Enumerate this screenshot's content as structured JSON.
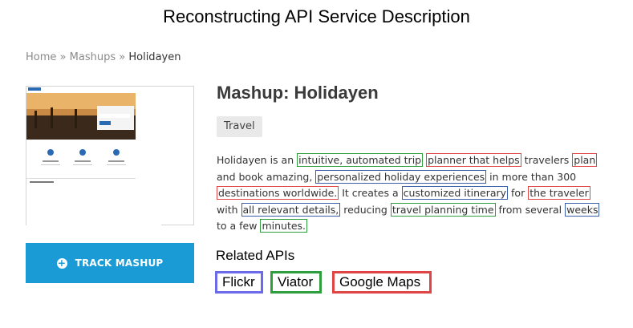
{
  "figure_title": "Reconstructing API Service Description",
  "breadcrumb": {
    "home": "Home",
    "sep1": "»",
    "mashups": "Mashups",
    "sep2": "»",
    "current": "Holidayen"
  },
  "track_button": {
    "label": "TRACK MASHUP",
    "icon": "plus-circle-icon"
  },
  "mashup": {
    "title": "Mashup: Holidayen",
    "tag": "Travel",
    "description_segments": [
      {
        "text": "Holidayen is an ",
        "hl": ""
      },
      {
        "text": "intuitive, automated trip",
        "hl": "green"
      },
      {
        "text": " ",
        "hl": ""
      },
      {
        "text": "planner that helps",
        "hl": "red"
      },
      {
        "text": " travelers ",
        "hl": ""
      },
      {
        "text": "plan",
        "hl": "red"
      },
      {
        "text": " and book amazing, ",
        "hl": ""
      },
      {
        "text": "personalized holiday experiences",
        "hl": "blue"
      },
      {
        "text": " in more than 300 ",
        "hl": ""
      },
      {
        "text": "destinations worldwide.",
        "hl": "red"
      },
      {
        "text": " It creates a ",
        "hl": ""
      },
      {
        "text": "customized itinerary",
        "hl": "blue"
      },
      {
        "text": " for ",
        "hl": ""
      },
      {
        "text": "the traveler",
        "hl": "red"
      },
      {
        "text": " with ",
        "hl": ""
      },
      {
        "text": "all relevant details,",
        "hl": "blue"
      },
      {
        "text": " reducing ",
        "hl": ""
      },
      {
        "text": "travel planning time",
        "hl": "green"
      },
      {
        "text": " from several ",
        "hl": ""
      },
      {
        "text": "weeks",
        "hl": "blue"
      },
      {
        "text": " to a few ",
        "hl": ""
      },
      {
        "text": "minutes.",
        "hl": "green"
      }
    ]
  },
  "related": {
    "heading": "Related APIs",
    "apis": [
      {
        "name": "Flickr",
        "color": "#6b6bea"
      },
      {
        "name": "Viator",
        "color": "#2e9e3e"
      },
      {
        "name": "Google Maps",
        "color": "#e04545"
      }
    ]
  },
  "colors": {
    "accent_button": "#1a9bd6",
    "highlight_green": "#2e9e3e",
    "highlight_red": "#e04545",
    "highlight_blue": "#3a5ea8"
  }
}
